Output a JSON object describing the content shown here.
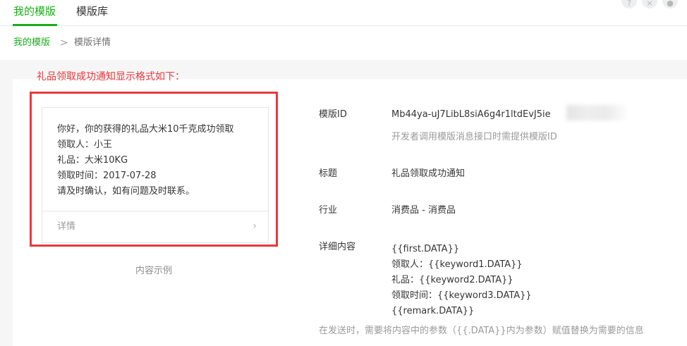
{
  "tabs": [
    {
      "label": "我的模版",
      "active": true
    },
    {
      "label": "模版库",
      "active": false
    }
  ],
  "top_icons": [
    "help-icon",
    "close-icon",
    "user-icon"
  ],
  "breadcrumb": {
    "parent": "我的模版",
    "separator": ">",
    "current": "模版详情"
  },
  "annotation": {
    "title": "礼品领取成功通知显示格式如下：",
    "color": "#e8383d"
  },
  "preview": {
    "lines": [
      "你好，你的获得的礼品大米10千克成功领取",
      "领取人：小王",
      "礼品：大米10KG",
      "领取时间：2017-07-28",
      "请及时确认，如有问题及时联系。"
    ],
    "detail_label": "详情",
    "chevron": "›",
    "caption": "内容示例"
  },
  "fields": {
    "template_id": {
      "label": "模版ID",
      "value": "Mb44ya-uJ7LibL8siA6g4r1ltdEvJ5ie",
      "hint": "开发者调用模版消息接口时需提供模版ID"
    },
    "title": {
      "label": "标题",
      "value": "礼品领取成功通知"
    },
    "industry": {
      "label": "行业",
      "value": "消费品 - 消费品"
    },
    "content": {
      "label": "详细内容",
      "lines": [
        "{{first.DATA}}",
        "领取人：{{keyword1.DATA}}",
        "礼品：{{keyword2.DATA}}",
        "领取时间：{{keyword3.DATA}}",
        "{{remark.DATA}}"
      ],
      "hint": "在发送时，需要将内容中的参数（{{.DATA}}内为参数）赋值替换为需要的信息"
    }
  },
  "colors": {
    "accent": "#1aad19",
    "highlight": "#e8383d"
  }
}
